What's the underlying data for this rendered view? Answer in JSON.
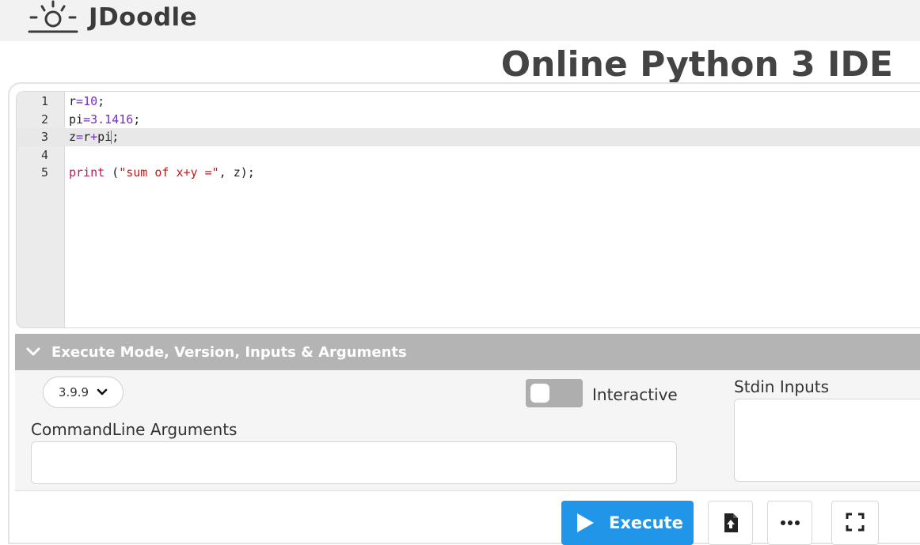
{
  "brand": {
    "name": "JDoodle"
  },
  "page": {
    "title": "Online Python 3 IDE"
  },
  "editor": {
    "active_line": 3,
    "lines": [
      {
        "number": "1",
        "code": "r=10;"
      },
      {
        "number": "2",
        "code": "pi=3.1416;"
      },
      {
        "number": "3",
        "code": "z=r+pi;"
      },
      {
        "number": "4",
        "code": ""
      },
      {
        "number": "5",
        "code": "print (\"sum of x+y =\", z);"
      }
    ]
  },
  "execute_panel": {
    "header": "Execute Mode, Version, Inputs & Arguments",
    "version_selected": "3.9.9",
    "interactive_label": "Interactive",
    "interactive_enabled": false,
    "stdin_label": "Stdin Inputs",
    "stdin_value": "",
    "args_label": "CommandLine Arguments",
    "args_value": ""
  },
  "actions": {
    "execute_label": "Execute",
    "icons": [
      "upload-file-icon",
      "more-options-icon",
      "fullscreen-icon"
    ]
  },
  "colors": {
    "accent": "#2196e8",
    "header_bg": "#b4b4b4",
    "keyword": "#c2185b",
    "string": "#c41a16",
    "number": "#7a2cc4"
  }
}
